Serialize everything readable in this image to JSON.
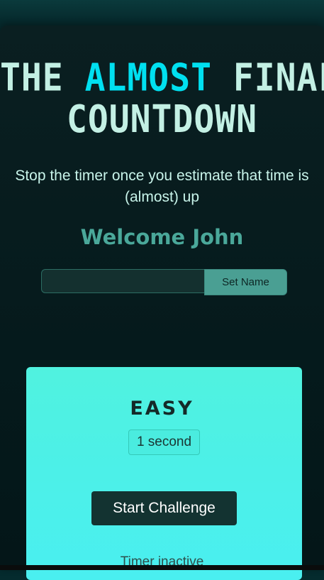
{
  "header": {
    "title_part1": "THE ",
    "title_accent": "ALMOST",
    "title_part2": " FINAL",
    "title_line2": "COUNTDOWN",
    "subtitle": "Stop the timer once you estimate that time is (almost) up"
  },
  "player": {
    "welcome_text": "Welcome John",
    "name_input_value": "",
    "name_input_placeholder": "",
    "set_name_label": "Set Name"
  },
  "challenge": {
    "difficulty": "EASY",
    "duration": "1 second",
    "start_label": "Start Challenge",
    "status_text": "Timer inactive"
  },
  "colors": {
    "title": "#c3f0e4",
    "title_accent": "#00e0f0",
    "welcome": "#4aa89a",
    "card": "#4ff0e6",
    "button_dark": "#133331"
  }
}
